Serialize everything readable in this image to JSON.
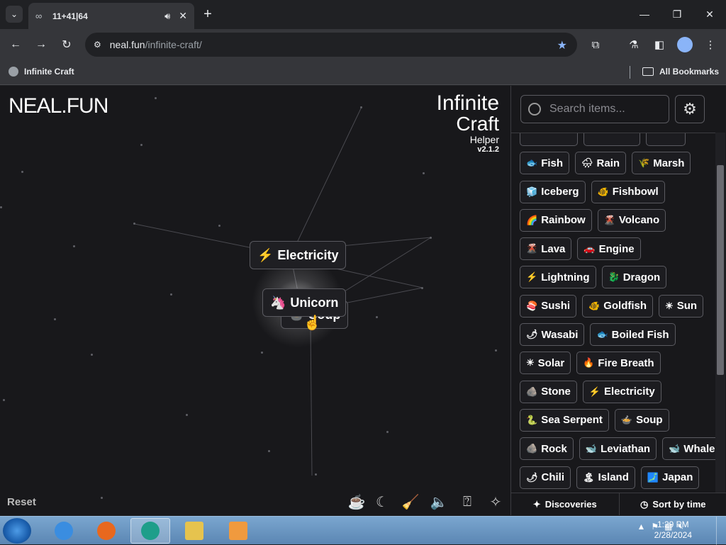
{
  "browser": {
    "tab": {
      "title": "11+41|64",
      "favicon": "infinity-icon"
    },
    "url": {
      "host": "neal.fun",
      "path": "/infinite-craft/"
    },
    "bookmarks": {
      "item": "Infinite Craft",
      "all": "All Bookmarks"
    }
  },
  "page": {
    "logo": "NEAL.FUN",
    "title_line1": "Infinite",
    "title_line2": "Craft",
    "title_line3": "Helper",
    "version": "v2.1.2",
    "reset_label": "Reset",
    "canvas_items": {
      "electricity": {
        "emoji": "⚡",
        "label": "Electricity"
      },
      "unicorn": {
        "emoji": "🦄",
        "label": "Unicorn"
      },
      "soup": {
        "emoji": "🍲",
        "label": "Soup"
      }
    },
    "search_placeholder": "Search items...",
    "sidebar_items": [
      [
        {
          "emoji": "🐟",
          "label": "Fish"
        },
        {
          "emoji": "🌧",
          "label": "Rain"
        },
        {
          "emoji": "🌾",
          "label": "Marsh"
        }
      ],
      [
        {
          "emoji": "🧊",
          "label": "Iceberg"
        },
        {
          "emoji": "🐠",
          "label": "Fishbowl"
        }
      ],
      [
        {
          "emoji": "🌈",
          "label": "Rainbow"
        },
        {
          "emoji": "🌋",
          "label": "Volcano"
        }
      ],
      [
        {
          "emoji": "🌋",
          "label": "Lava"
        },
        {
          "emoji": "🚗",
          "label": "Engine"
        }
      ],
      [
        {
          "emoji": "⚡",
          "label": "Lightning"
        },
        {
          "emoji": "🐉",
          "label": "Dragon"
        }
      ],
      [
        {
          "emoji": "🍣",
          "label": "Sushi"
        },
        {
          "emoji": "🐠",
          "label": "Goldfish"
        },
        {
          "emoji": "☀",
          "label": "Sun"
        }
      ],
      [
        {
          "emoji": "🌶",
          "label": "Wasabi"
        },
        {
          "emoji": "🐟",
          "label": "Boiled Fish"
        }
      ],
      [
        {
          "emoji": "☀",
          "label": "Solar"
        },
        {
          "emoji": "🔥",
          "label": "Fire Breath"
        }
      ],
      [
        {
          "emoji": "🪨",
          "label": "Stone"
        },
        {
          "emoji": "⚡",
          "label": "Electricity"
        }
      ],
      [
        {
          "emoji": "🐍",
          "label": "Sea Serpent"
        },
        {
          "emoji": "🍲",
          "label": "Soup"
        }
      ],
      [
        {
          "emoji": "🪨",
          "label": "Rock"
        },
        {
          "emoji": "🐋",
          "label": "Leviathan"
        },
        {
          "emoji": "🐋",
          "label": "Whale"
        }
      ],
      [
        {
          "emoji": "🌶",
          "label": "Chili"
        },
        {
          "emoji": "🏝",
          "label": "Island"
        },
        {
          "emoji": "🗾",
          "label": "Japan"
        }
      ]
    ],
    "footer": {
      "discoveries": "Discoveries",
      "sort": "Sort by time"
    }
  },
  "taskbar": {
    "time": "1:29 PM",
    "date": "2/28/2024"
  }
}
